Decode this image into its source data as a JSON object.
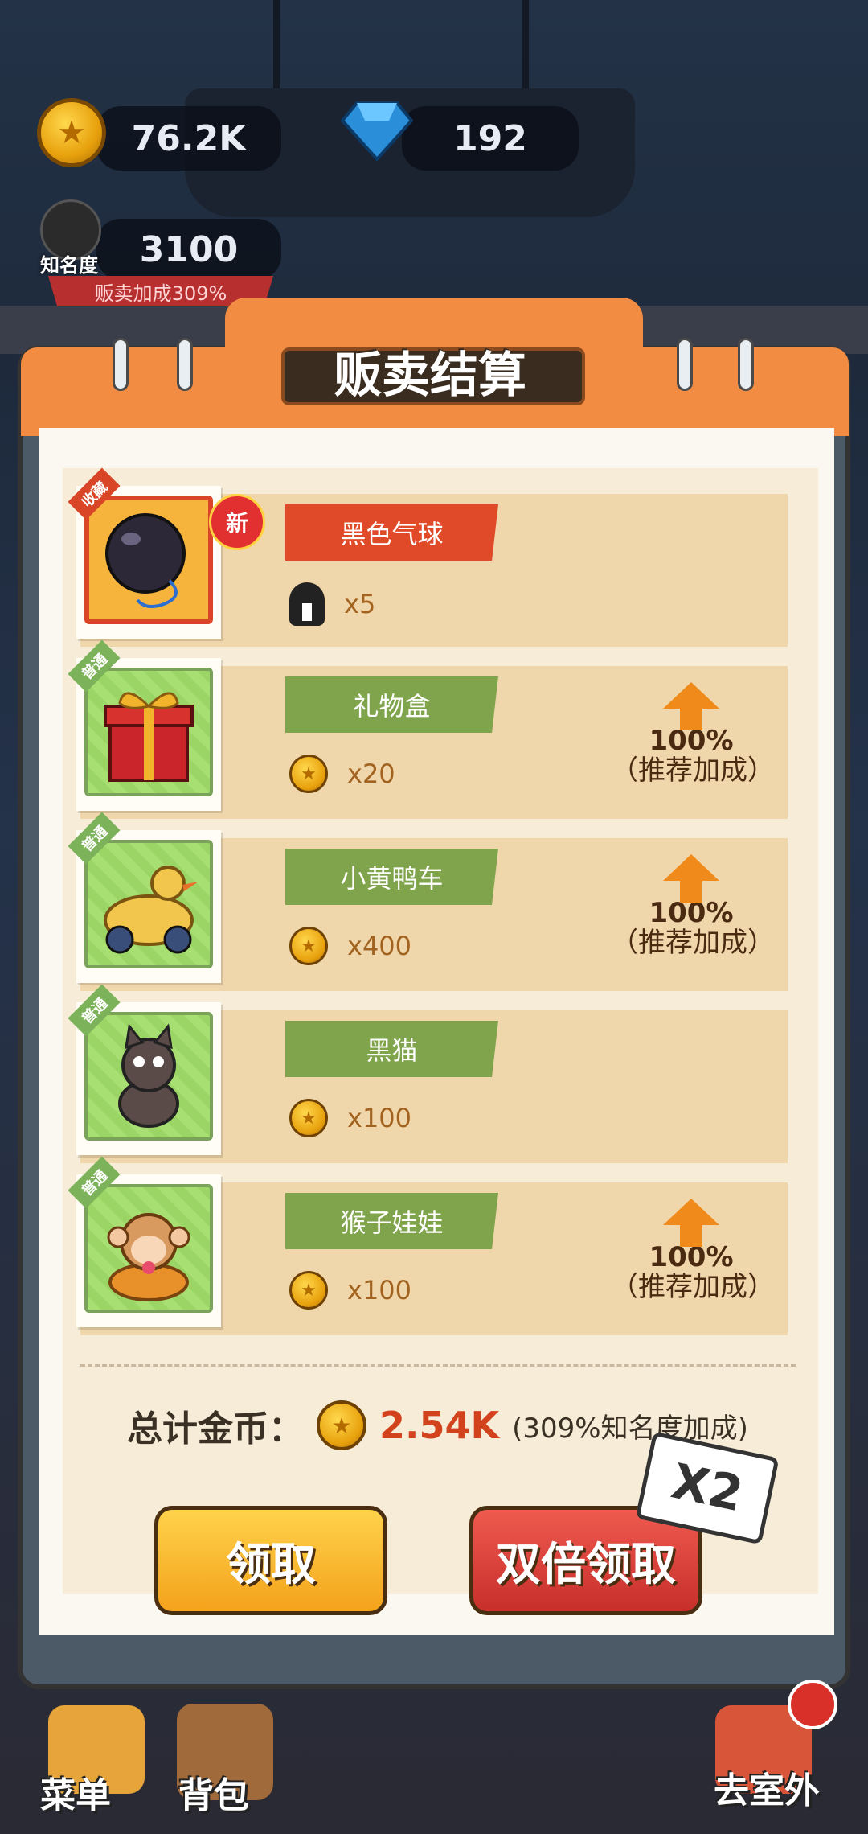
{
  "hud": {
    "coins": "76.2K",
    "gems": "192",
    "fame_label": "知名度",
    "fame_value": "3100",
    "sell_bonus": "贩卖加成309%"
  },
  "dialog": {
    "title": "贩卖结算",
    "items": [
      {
        "tag": "收藏",
        "badge": "新",
        "name": "黑色气球",
        "currency": "fame",
        "amount": "x5",
        "boost": null
      },
      {
        "tag": "普通",
        "name": "礼物盒",
        "currency": "coin",
        "amount": "x20",
        "boost": {
          "percent": "100%",
          "label": "（推荐加成）"
        }
      },
      {
        "tag": "普通",
        "name": "小黄鸭车",
        "currency": "coin",
        "amount": "x400",
        "boost": {
          "percent": "100%",
          "label": "（推荐加成）"
        }
      },
      {
        "tag": "普通",
        "name": "黑猫",
        "currency": "coin",
        "amount": "x100",
        "boost": null
      },
      {
        "tag": "普通",
        "name": "猴子娃娃",
        "currency": "coin",
        "amount": "x100",
        "boost": {
          "percent": "100%",
          "label": "（推荐加成）"
        }
      }
    ],
    "total_label": "总计金币：",
    "total_value": "2.54K",
    "total_note": "(309%知名度加成)",
    "claim_button": "领取",
    "double_claim_button": "双倍领取",
    "x2_tag": "X2"
  },
  "nav": {
    "menu": "菜单",
    "bag": "背包",
    "outdoor": "去室外"
  },
  "colors": {
    "accent_orange": "#f28c43",
    "ribbon_red": "#e04a28",
    "ribbon_green": "#7fa44c",
    "total_red": "#d2421c"
  }
}
